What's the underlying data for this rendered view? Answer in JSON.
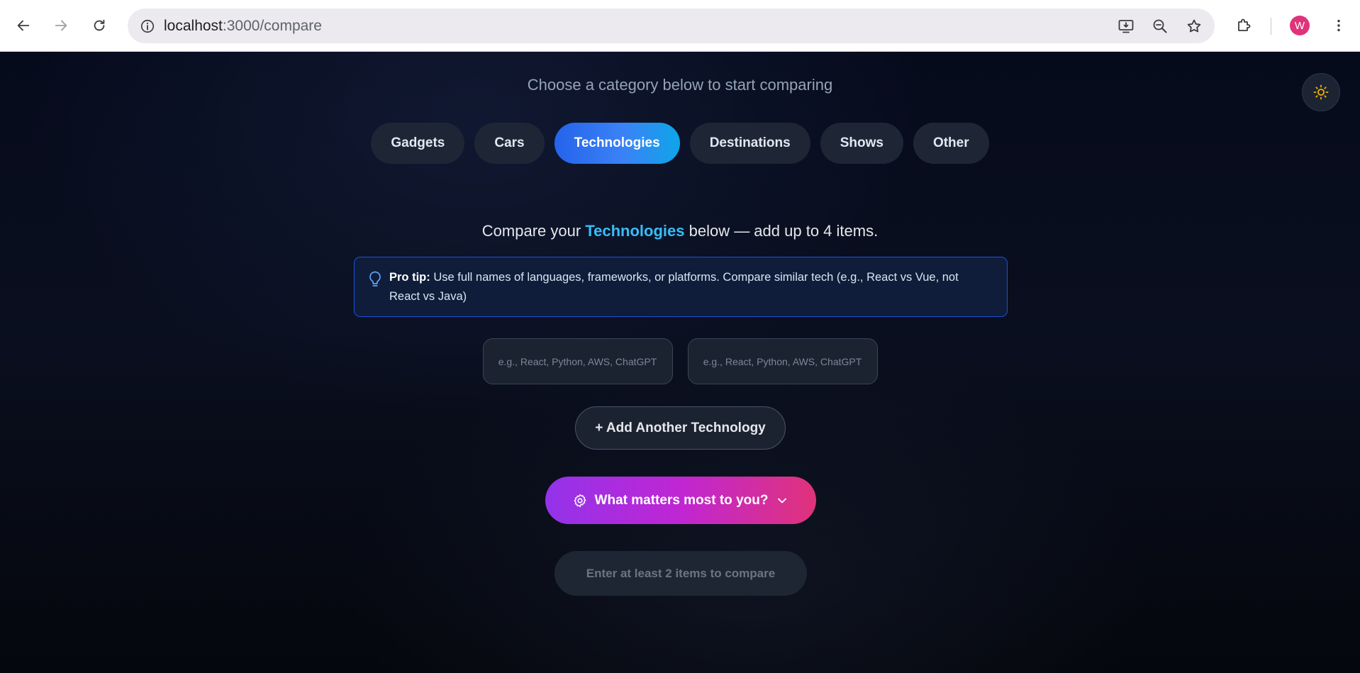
{
  "browser": {
    "url_host": "localhost",
    "url_path": ":3000/compare",
    "avatar_initial": "W"
  },
  "header": {
    "subtitle": "Choose a category below to start comparing",
    "theme_toggle_icon": "sun-icon"
  },
  "categories": [
    {
      "label": "Gadgets",
      "active": false
    },
    {
      "label": "Cars",
      "active": false
    },
    {
      "label": "Technologies",
      "active": true
    },
    {
      "label": "Destinations",
      "active": false
    },
    {
      "label": "Shows",
      "active": false
    },
    {
      "label": "Other",
      "active": false
    }
  ],
  "compare": {
    "prefix": "Compare your ",
    "category": "Technologies",
    "suffix": " below — add up to 4 items."
  },
  "tip": {
    "label": "Pro tip:",
    "text": " Use full names of languages, frameworks, or platforms. Compare similar tech (e.g., React vs Vue, not React vs Java)"
  },
  "items": [
    {
      "value": "",
      "placeholder": "e.g., React, Python, AWS, ChatGPT"
    },
    {
      "value": "",
      "placeholder": "e.g., React, Python, AWS, ChatGPT"
    }
  ],
  "actions": {
    "add_label": "+ Add Another Technology",
    "matters_label": "What matters most to you?",
    "submit_label": "Enter at least 2 items to compare"
  },
  "colors": {
    "accent_blue": "#3b82f6",
    "highlight": "#38bdf8",
    "gradient_start": "#9333ea",
    "gradient_end": "#e0337a",
    "sun": "#f5b301"
  }
}
